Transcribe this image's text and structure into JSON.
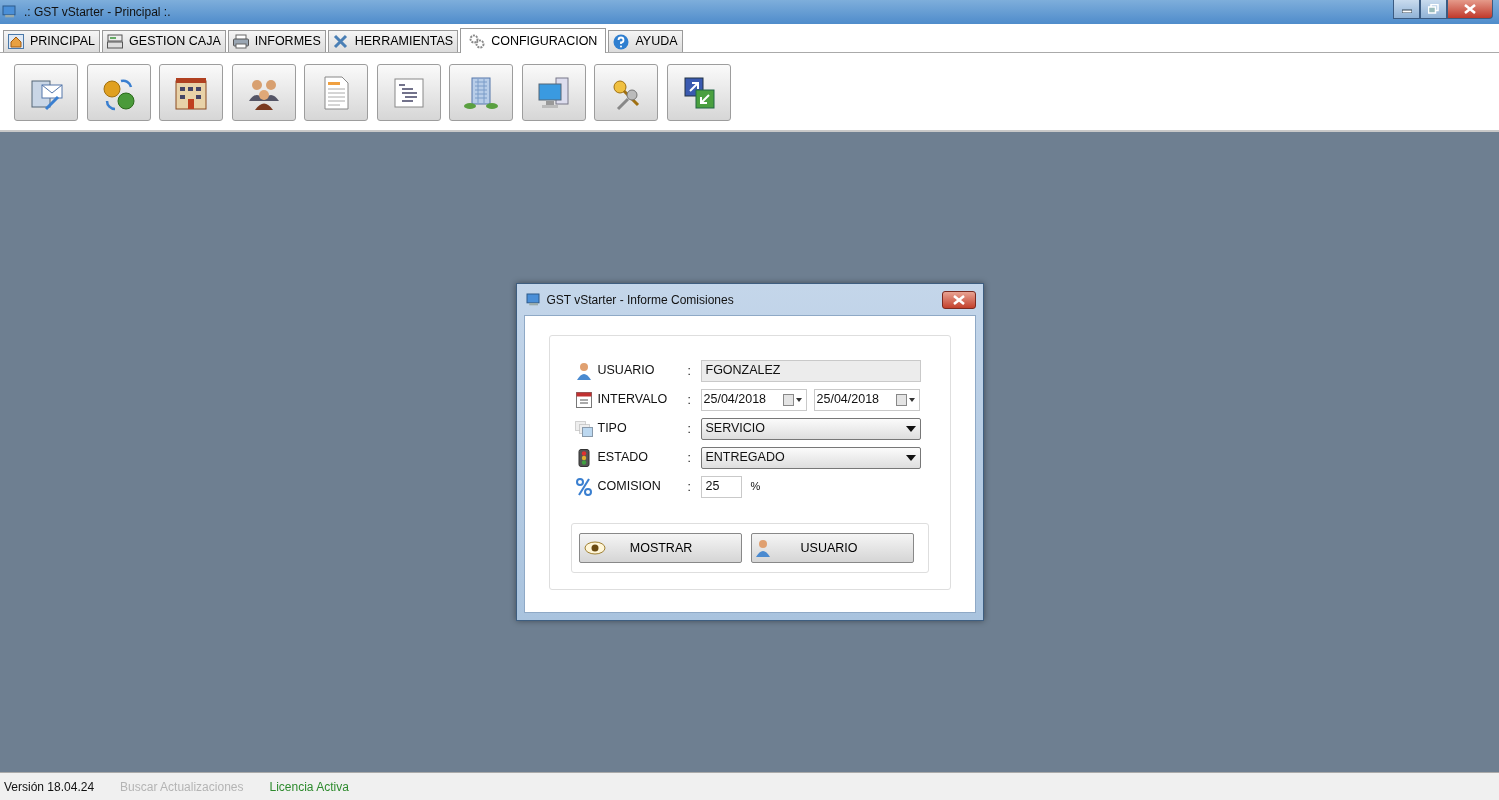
{
  "window": {
    "title": ".: GST vStarter - Principal :."
  },
  "tabs": [
    {
      "label": "PRINCIPAL",
      "selected": false
    },
    {
      "label": "GESTION CAJA",
      "selected": false
    },
    {
      "label": "INFORMES",
      "selected": false
    },
    {
      "label": "HERRAMIENTAS",
      "selected": false
    },
    {
      "label": "CONFIGURACION",
      "selected": true
    },
    {
      "label": "AYUDA",
      "selected": false
    }
  ],
  "dialog": {
    "title": "GST vStarter - Informe Comisiones",
    "fields": [
      {
        "kind": "readonly",
        "label": "USUARIO",
        "value": "FGONZALEZ"
      },
      {
        "kind": "daterange",
        "label": "INTERVALO",
        "values": [
          "25/04/2018",
          "25/04/2018"
        ]
      },
      {
        "kind": "select",
        "label": "TIPO",
        "value": "SERVICIO"
      },
      {
        "kind": "select",
        "label": "ESTADO",
        "value": "ENTREGADO"
      },
      {
        "kind": "number",
        "label": "COMISION",
        "value": "25",
        "unit": "%"
      }
    ],
    "separator": ":",
    "buttons": [
      "MOSTRAR",
      "USUARIO"
    ]
  },
  "status_bar": {
    "version": "Versión 18.04.24",
    "update_link": {
      "label": "Buscar Actualizaciones",
      "disabled": true
    },
    "license": "Licencia Activa"
  }
}
